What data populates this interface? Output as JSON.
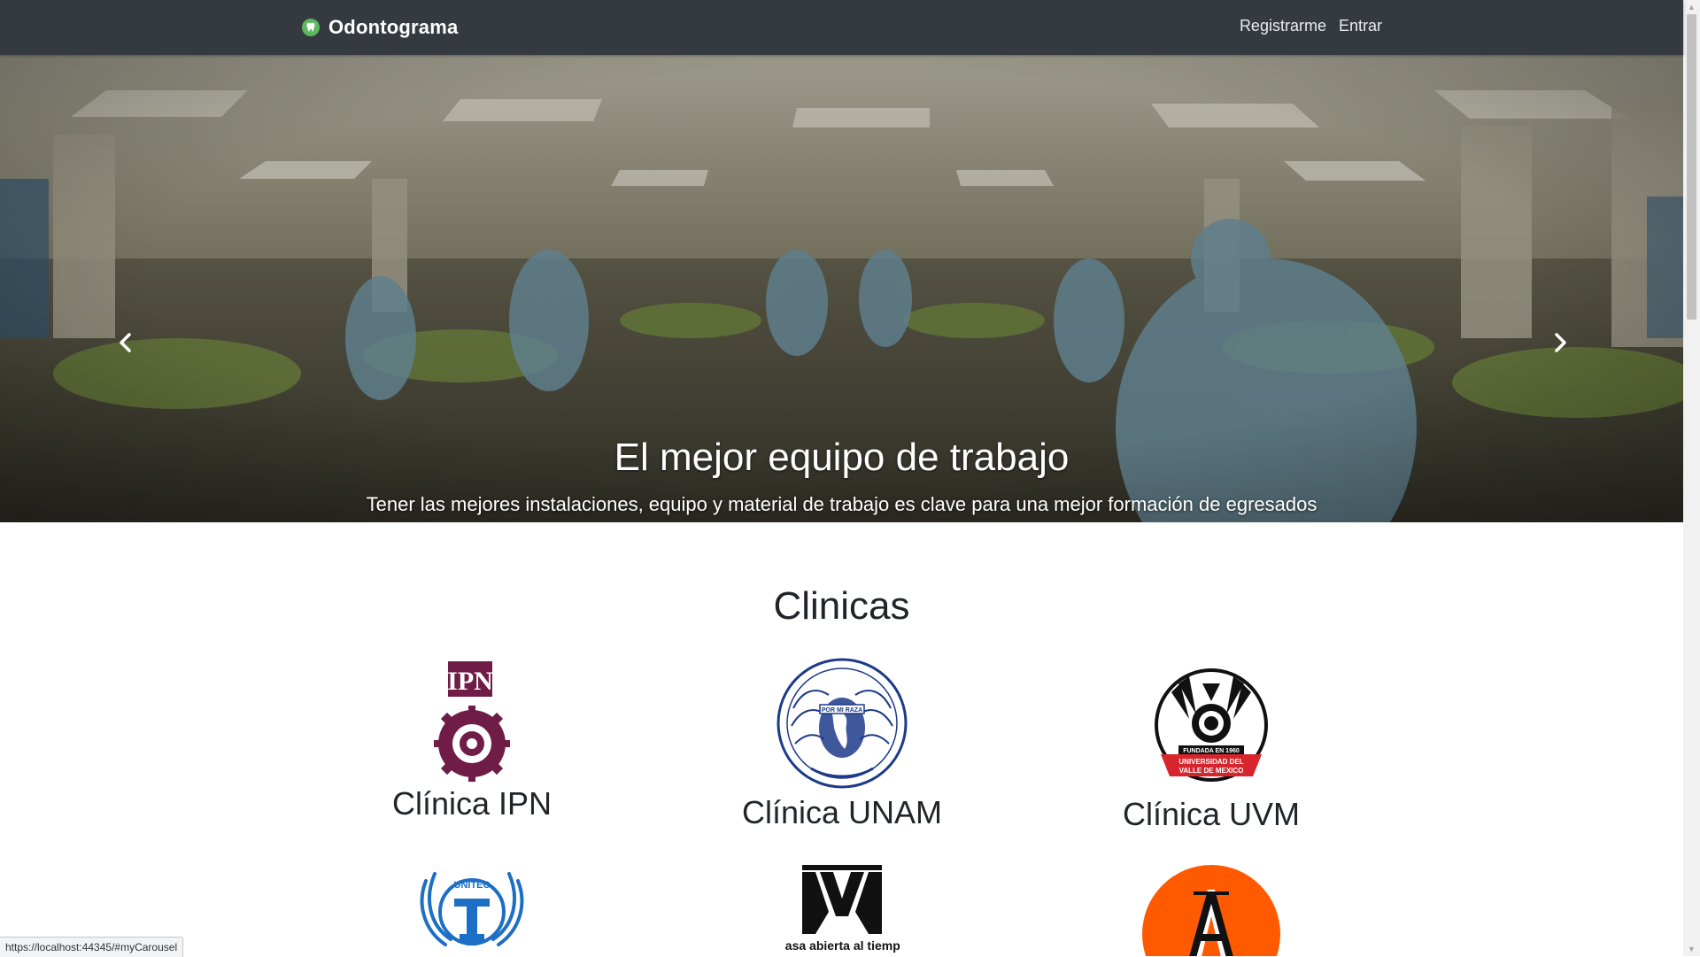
{
  "navbar": {
    "brand": "Odontograma",
    "brand_icon": "tooth-icon",
    "links": [
      {
        "label": "Registrarme"
      },
      {
        "label": "Entrar"
      }
    ]
  },
  "carousel": {
    "title": "El mejor equipo de trabajo",
    "text": "Tener las mejores instalaciones, equipo y material de trabajo es clave para una mejor formación de egresados",
    "prev_icon": "chevron-left-icon",
    "next_icon": "chevron-right-icon",
    "slide_count": 3,
    "active_slide": 2
  },
  "clinics": {
    "title": "Clinicas",
    "items": [
      {
        "name": "Clínica IPN",
        "logo": "ipn-logo",
        "logo_text": "IPN"
      },
      {
        "name": "Clínica UNAM",
        "logo": "unam-seal-logo",
        "logo_text": "POR MI RAZA HABLARA EL ESPIRITU"
      },
      {
        "name": "Clínica UVM",
        "logo": "uvm-seal-logo",
        "logo_text": "FUNDADA EN 1960 UNIVERSIDAD DEL VALLE DE MEXICO"
      },
      {
        "name": "",
        "logo": "unitec-logo",
        "logo_text": "UNITEC"
      },
      {
        "name": "",
        "logo": "uam-logo",
        "logo_text": "Casa abierta al tiempo"
      },
      {
        "name": "",
        "logo": "anahuac-logo",
        "logo_text": "A"
      }
    ]
  },
  "status_url": "https://localhost:44345/#myCarousel",
  "colors": {
    "navbar_bg": "#343a40",
    "brand_icon": "#28a745",
    "ipn_maroon": "#6f1d46",
    "unam_blue": "#1d3a8a",
    "uvm_red": "#d6252c",
    "unitec_blue": "#1c6fc4",
    "anahuac_orange": "#ff5a00"
  }
}
